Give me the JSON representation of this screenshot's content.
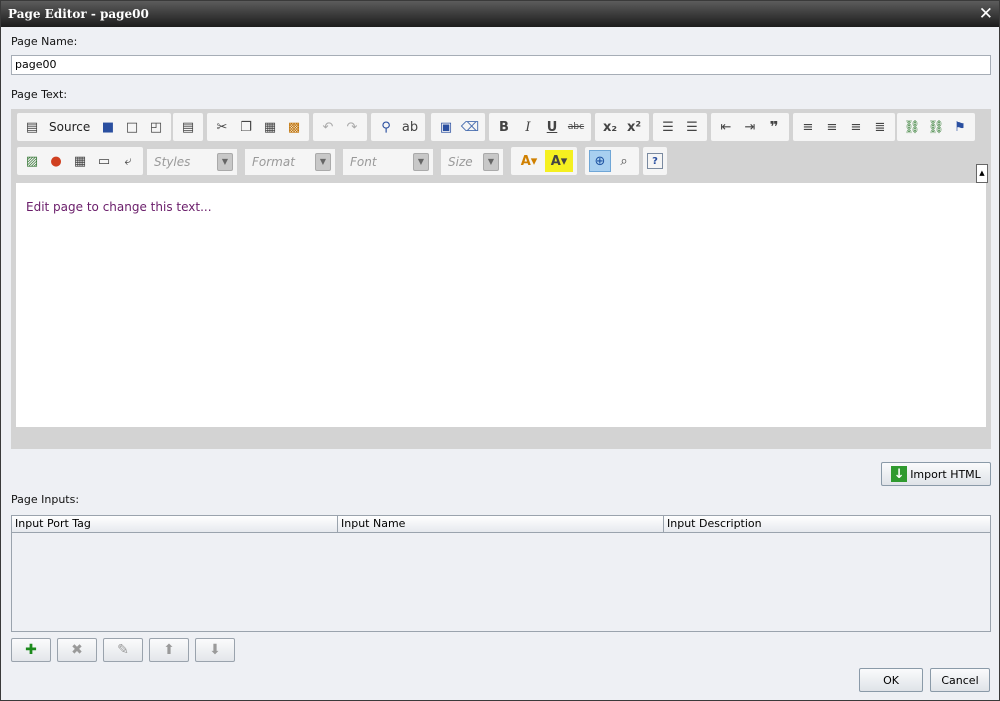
{
  "window": {
    "title": "Page Editor - page00",
    "close_icon": "close-icon"
  },
  "page_name": {
    "label": "Page Name:",
    "value": "page00"
  },
  "page_text": {
    "label": "Page Text:"
  },
  "toolbar": {
    "source_label": "Source",
    "styles_placeholder": "Styles",
    "format_placeholder": "Format",
    "font_placeholder": "Font",
    "size_placeholder": "Size"
  },
  "editor": {
    "content": "Edit page to change this text..."
  },
  "import_html_label": "Import HTML",
  "page_inputs": {
    "label": "Page Inputs:",
    "columns": [
      "Input Port Tag",
      "Input Name",
      "Input Description"
    ],
    "rows": []
  },
  "buttons": {
    "ok": "OK",
    "cancel": "Cancel"
  },
  "colors": {
    "content_text": "#6a1d6a",
    "titlebar": "#2a2a2a",
    "accent_green": "#2f9a2f"
  }
}
